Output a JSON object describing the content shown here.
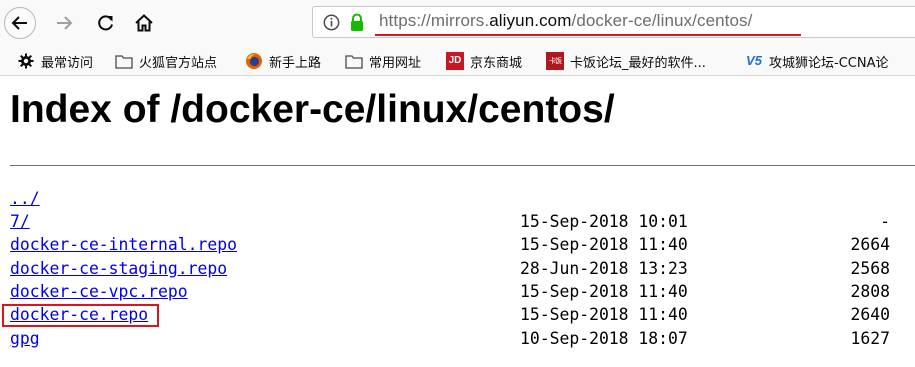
{
  "url": {
    "prefix": "https://mirrors.",
    "domain": "aliyun.com",
    "path": "/docker-ce/linux/centos/"
  },
  "bookmarks": [
    {
      "label": "最常访问",
      "icon": "gear-icon"
    },
    {
      "label": "火狐官方站点",
      "icon": "folder-icon"
    },
    {
      "label": "新手上路",
      "icon": "firefox-icon"
    },
    {
      "label": "常用网址",
      "icon": "folder-icon"
    },
    {
      "label": "京东商城",
      "icon": "jd-icon",
      "icon_text": "JD"
    },
    {
      "label": "卡饭论坛_最好的软件...",
      "icon": "kafan-icon",
      "icon_text": "卡饭"
    },
    {
      "label": "攻城狮论坛-CCNA论",
      "icon": "v5-icon",
      "icon_text": "V5"
    }
  ],
  "page": {
    "heading": "Index of /docker-ce/linux/centos/",
    "entries": [
      {
        "name": "../",
        "date": "",
        "size": ""
      },
      {
        "name": "7/",
        "date": "15-Sep-2018 10:01",
        "size": "-"
      },
      {
        "name": "docker-ce-internal.repo",
        "date": "15-Sep-2018 11:40",
        "size": "2664"
      },
      {
        "name": "docker-ce-staging.repo",
        "date": "28-Jun-2018 13:23",
        "size": "2568"
      },
      {
        "name": "docker-ce-vpc.repo",
        "date": "15-Sep-2018 11:40",
        "size": "2808"
      },
      {
        "name": "docker-ce.repo",
        "date": "15-Sep-2018 11:40",
        "size": "2640"
      },
      {
        "name": "gpg",
        "date": "10-Sep-2018 18:07",
        "size": "1627"
      }
    ]
  },
  "colors": {
    "link": "#0000ee",
    "annotation_red": "#d9161c",
    "lock_green": "#12bc00",
    "jd_red": "#c91623"
  }
}
